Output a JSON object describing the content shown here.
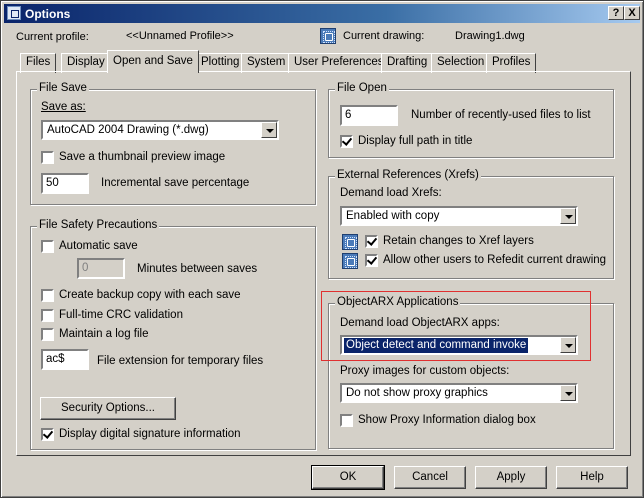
{
  "window": {
    "title": "Options",
    "help_btn": "?",
    "close_btn": "X"
  },
  "header": {
    "profile_label": "Current profile:",
    "profile_value": "<<Unnamed Profile>>",
    "drawing_label": "Current drawing:",
    "drawing_value": "Drawing1.dwg"
  },
  "tabs": [
    "Files",
    "Display",
    "Open and Save",
    "Plotting",
    "System",
    "User Preferences",
    "Drafting",
    "Selection",
    "Profiles"
  ],
  "file_save": {
    "title": "File Save",
    "save_as_label": "Save as:",
    "save_as_value": "AutoCAD 2004 Drawing (*.dwg)",
    "thumbnail_label": "Save a thumbnail preview image",
    "incremental_value": "50",
    "incremental_label": "Incremental save percentage"
  },
  "file_safety": {
    "title": "File Safety Precautions",
    "autosave_label": "Automatic save",
    "minutes_value": "0",
    "minutes_label": "Minutes between saves",
    "backup_label": "Create backup copy with each save",
    "crc_label": "Full-time CRC validation",
    "log_label": "Maintain a log file",
    "ext_value": "ac$",
    "ext_label": "File extension for temporary files",
    "security_button": "Security Options...",
    "digsig_label": "Display digital signature information"
  },
  "file_open": {
    "title": "File Open",
    "recent_value": "6",
    "recent_label": "Number of recently-used files to list",
    "fullpath_label": "Display full path in title"
  },
  "xrefs": {
    "title": "External References (Xrefs)",
    "demand_label": "Demand load Xrefs:",
    "demand_value": "Enabled with copy",
    "retain_label": "Retain changes to Xref layers",
    "refedit_label": "Allow other users to Refedit current drawing"
  },
  "objectarx": {
    "title": "ObjectARX Applications",
    "demand_label": "Demand load ObjectARX apps:",
    "demand_value": "Object detect and command invoke",
    "proxy_label": "Proxy images for custom objects:",
    "proxy_value": "Do not show proxy graphics",
    "proxy_info_label": "Show Proxy Information dialog box"
  },
  "footer": {
    "ok": "OK",
    "cancel": "Cancel",
    "apply": "Apply",
    "help": "Help"
  },
  "checked_states": {
    "thumbnail": false,
    "autosave": false,
    "backup": false,
    "crc": false,
    "log": false,
    "digsig": true,
    "fullpath": true,
    "retain": true,
    "refedit": true,
    "proxy_info": false
  },
  "colors": {
    "title_start": "#0a246a",
    "title_end": "#a6caf0",
    "face": "#d4d0c8",
    "highlight_box": "#e03030",
    "selection": "#0a246a"
  }
}
